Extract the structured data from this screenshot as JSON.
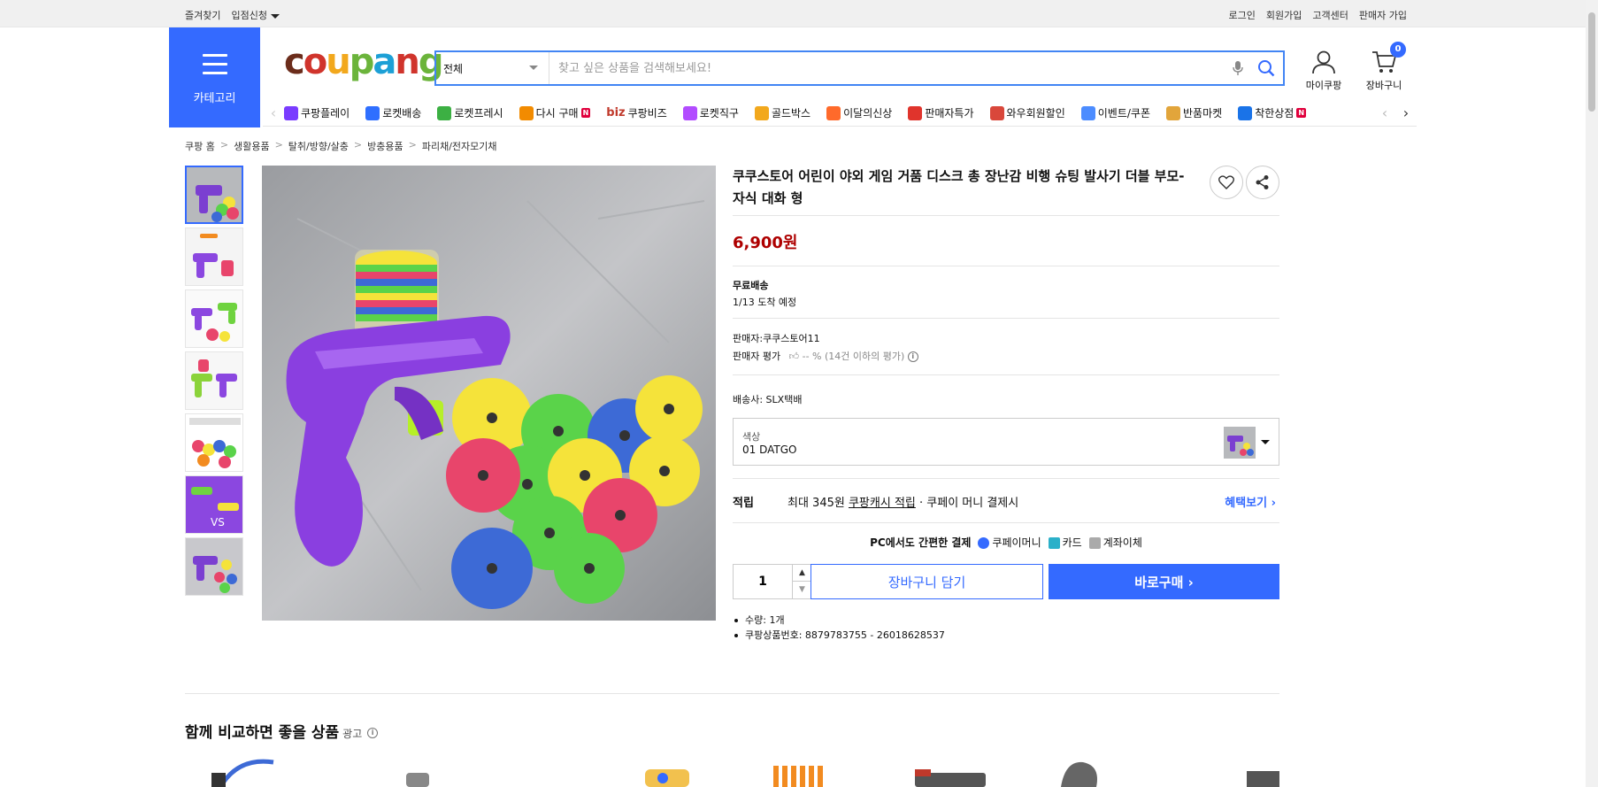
{
  "topbar": {
    "left": [
      "즐겨찾기",
      "입점신청"
    ],
    "right": [
      "로그인",
      "회원가입",
      "고객센터",
      "판매자 가입"
    ]
  },
  "header": {
    "category_label": "카테고리",
    "logo_text": "coupang",
    "search_scope": "전체",
    "search_placeholder": "찾고 싶은 상품을 검색해보세요!",
    "mypage_label": "마이쿠팡",
    "cart_label": "장바구니",
    "cart_count": "0"
  },
  "nav": {
    "items": [
      {
        "label": "쿠팡플레이",
        "icon": "play-icon",
        "color": "#7a3cff"
      },
      {
        "label": "로켓배송",
        "icon": "rocket-icon",
        "color": "#2f6fff"
      },
      {
        "label": "로켓프레시",
        "icon": "rocket-fresh-icon",
        "color": "#3cb043"
      },
      {
        "label": "다시 구매",
        "icon": "repurchase-icon",
        "color": "#f28b00",
        "badge": "N"
      },
      {
        "label": "쿠팡비즈",
        "icon": "biz-icon",
        "color": "#c0392b",
        "prefix": "biz"
      },
      {
        "label": "로켓직구",
        "icon": "global-rocket-icon",
        "color": "#b24cff"
      },
      {
        "label": "골드박스",
        "icon": "goldbox-icon",
        "color": "#f2a81d"
      },
      {
        "label": "이달의신상",
        "icon": "new-arrival-icon",
        "color": "#ff6a2b"
      },
      {
        "label": "판매자특가",
        "icon": "seller-deal-icon",
        "color": "#e0342c"
      },
      {
        "label": "와우회원할인",
        "icon": "wow-icon",
        "color": "#d9473b"
      },
      {
        "label": "이벤트/쿠폰",
        "icon": "coupon-icon",
        "color": "#4c8cff"
      },
      {
        "label": "반품마켓",
        "icon": "return-market-icon",
        "color": "#e2a53b"
      },
      {
        "label": "착한상점",
        "icon": "good-store-icon",
        "color": "#1a73e8",
        "badge": "N"
      }
    ]
  },
  "breadcrumb": [
    "쿠팡 홈",
    "생활용품",
    "탈취/방향/살충",
    "방충용품",
    "파리채/전자모기채"
  ],
  "product": {
    "title": "쿠쿠스토어 어린이 야외 게임 거품 디스크 총 장난감 비행 슈팅 발사기 더블 부모-자식 대화 형",
    "price": "6,900원",
    "shipping_title": "무료배송",
    "shipping_eta": "1/13 도착 예정",
    "seller": "판매자:쿠쿠스토어11",
    "seller_rating_label": "판매자 평가",
    "seller_rating_value": "-- % (14건 이하의 평가)",
    "courier": "배송사:  SLX택배",
    "option_label": "색상",
    "option_value": "01 DATGO",
    "reward_label": "적립",
    "reward_pre": "최대 345원 ",
    "reward_link": "쿠팡캐시 적립",
    "reward_post": " · 쿠페이 머니 결제시",
    "reward_more": "혜택보기",
    "pay_title": "PC에서도 간편한 결제",
    "pay_methods": [
      "쿠페이머니",
      "카드",
      "계좌이체"
    ],
    "quantity": "1",
    "add_to_cart": "장바구니 담기",
    "buy_now": "바로구매",
    "bullets": [
      "수량: 1개",
      "쿠팡상품번호: 8879783755 - 26018628537"
    ]
  },
  "compare": {
    "title": "함께 비교하면 좋을 상품",
    "ad_label": "광고"
  },
  "colors": {
    "accent": "#346aff",
    "price": "#ae0000"
  }
}
